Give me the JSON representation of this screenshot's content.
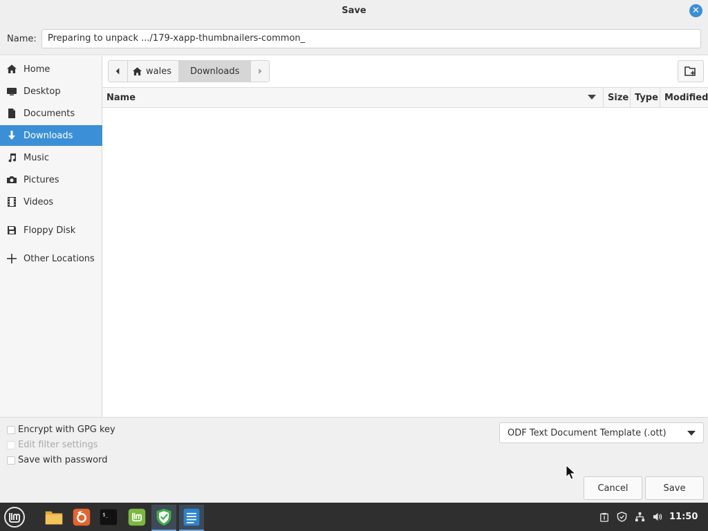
{
  "dialog": {
    "title": "Save",
    "name_label": "Name:",
    "name_value": "Preparing to unpack .../179-xapp-thumbnailers-common_"
  },
  "sidebar": {
    "items": [
      {
        "label": "Home",
        "icon": "home-icon"
      },
      {
        "label": "Desktop",
        "icon": "desktop-icon"
      },
      {
        "label": "Documents",
        "icon": "documents-icon"
      },
      {
        "label": "Downloads",
        "icon": "downloads-icon",
        "active": true
      },
      {
        "label": "Music",
        "icon": "music-icon"
      },
      {
        "label": "Pictures",
        "icon": "pictures-icon"
      },
      {
        "label": "Videos",
        "icon": "videos-icon"
      },
      {
        "label": "Floppy Disk",
        "icon": "floppy-disk-icon"
      },
      {
        "label": "Other Locations",
        "icon": "plus-icon"
      }
    ]
  },
  "pathbar": {
    "parent": "wales",
    "current": "Downloads"
  },
  "columns": {
    "name": "Name",
    "size": "Size",
    "type": "Type",
    "modified": "Modified"
  },
  "options": {
    "encrypt": "Encrypt with GPG key",
    "edit_filter": "Edit filter settings",
    "save_password": "Save with password"
  },
  "filter": {
    "selected": "ODF Text Document Template (.ott)"
  },
  "buttons": {
    "cancel": "Cancel",
    "save": "Save"
  },
  "taskbar": {
    "clock": "11:50"
  },
  "colors": {
    "accent": "#3b8fd6",
    "taskbar": "#2f2f2f"
  }
}
